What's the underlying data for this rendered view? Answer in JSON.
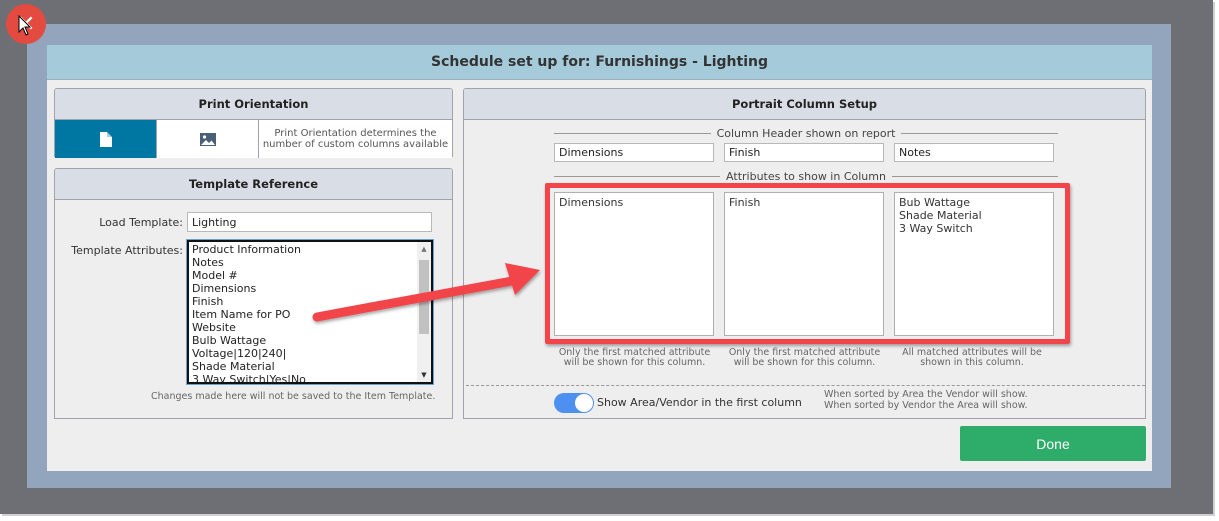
{
  "dialog": {
    "title": "Schedule set up for: Furnishings - Lighting"
  },
  "print_orientation": {
    "heading": "Print Orientation",
    "options": [
      {
        "name": "portrait",
        "icon": "document-icon",
        "selected": true
      },
      {
        "name": "landscape",
        "icon": "image-icon",
        "selected": false
      }
    ],
    "description": "Print Orientation determines the number of custom columns available"
  },
  "template_reference": {
    "heading": "Template Reference",
    "load_template_label": "Load Template:",
    "load_template_value": "Lighting",
    "attributes_label": "Template Attributes:",
    "attributes": [
      "Product Information",
      "Notes",
      "Model #",
      "Dimensions",
      "Finish",
      "Item Name for PO",
      "Website",
      "Bulb Wattage",
      "Voltage|120|240|",
      "Shade Material",
      "3 Way Switch|Yes|No"
    ],
    "note": "Changes made here will not be saved to the Item Template."
  },
  "portrait_setup": {
    "heading": "Portrait Column Setup",
    "column_header_label": "Column Header shown on report",
    "attributes_label": "Attributes to show in Column",
    "columns": [
      {
        "header": "Dimensions",
        "attributes": "Dimensions",
        "hint": "Only the first matched attribute will be shown for this column."
      },
      {
        "header": "Finish",
        "attributes": "Finish",
        "hint": "Only the first matched attribute will be shown for this column."
      },
      {
        "header": "Notes",
        "attributes": "Bub Wattage\nShade Material\n3 Way Switch",
        "hint": "All matched attributes will be shown in this column."
      }
    ],
    "toggle_label": "Show Area/Vendor in the first column",
    "toggle_on": true,
    "toggle_note_1": "When sorted by Area the Vendor will show.",
    "toggle_note_2": "When sorted by Vendor the Area will show."
  },
  "actions": {
    "done_label": "Done"
  },
  "colors": {
    "accent_blue": "#0077a3",
    "title_bar": "#a5cad9",
    "done_green": "#2eac6a",
    "annotation_red": "#f2444a",
    "toggle_blue": "#4d90f0"
  }
}
